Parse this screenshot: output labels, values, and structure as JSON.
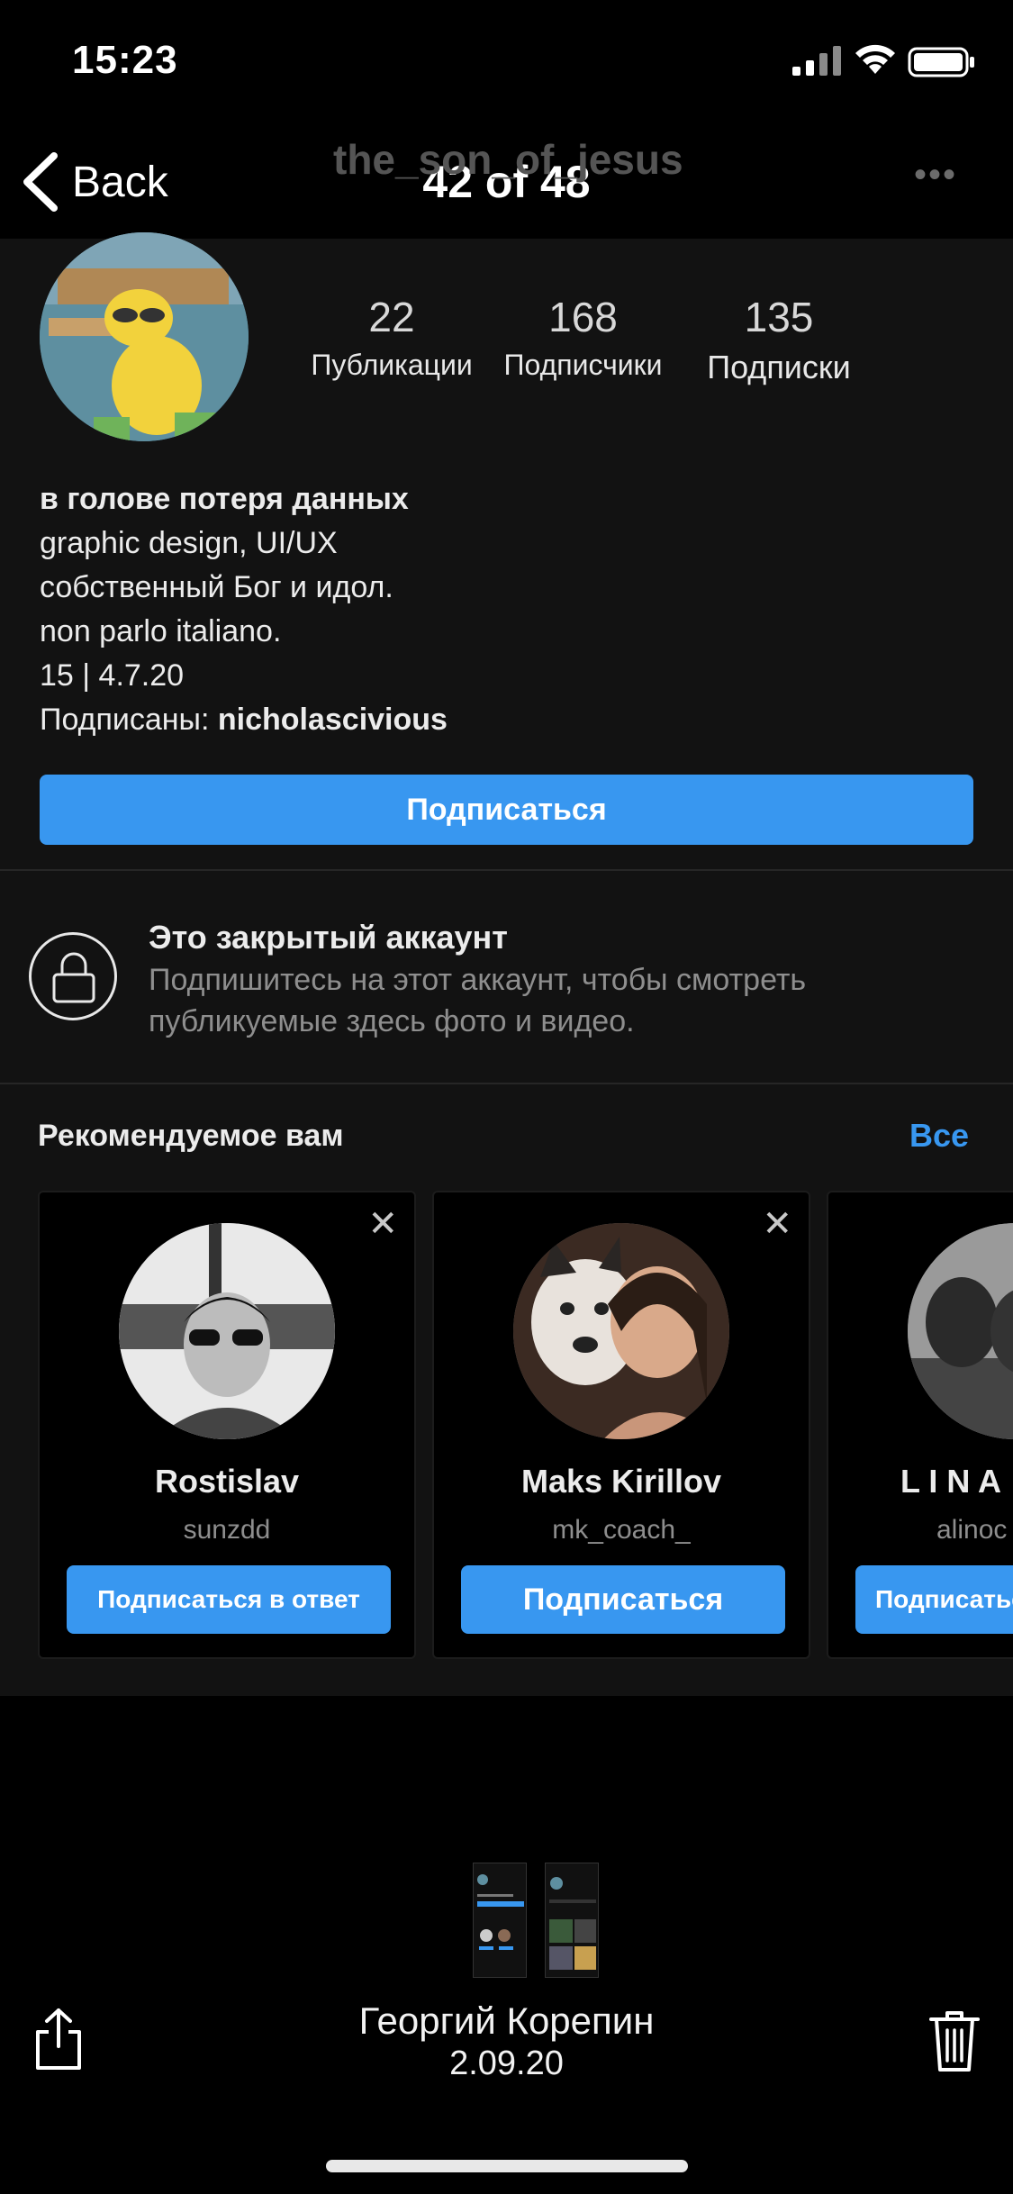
{
  "status_bar": {
    "time": "15:23"
  },
  "viewer": {
    "back_label": "Back",
    "counter": "42 of 48",
    "sender_name": "Георгий Корепин",
    "sent_date": "2.09.20"
  },
  "profile": {
    "username_header": "the_son_of_jesus",
    "stats": [
      {
        "value": "22",
        "label": "Публикации"
      },
      {
        "value": "168",
        "label": "Подписчики"
      },
      {
        "value": "135",
        "label": "Подписки"
      }
    ],
    "bio_name": "в голове потеря данных",
    "bio_lines": [
      "graphic design, UI/UX",
      "собственный Бог и идол.",
      "non parlo italiano.",
      "15 | 4.7.20"
    ],
    "followed_by_prefix": "Подписаны: ",
    "followed_by_user": "nicholascivious",
    "follow_button": "Подписаться",
    "private_title": "Это закрытый аккаунт",
    "private_subtitle": "Подпишитесь на этот аккаунт, чтобы смотреть публикуемые здесь фото и видео."
  },
  "suggestions": {
    "title": "Рекомендуемое вам",
    "see_all": "Все",
    "cards": [
      {
        "name": "Rostislav",
        "handle": "sunzdd",
        "button": "Подписаться в ответ"
      },
      {
        "name": "Maks Kirillov",
        "handle": "mk_coach_",
        "button": "Подписаться"
      },
      {
        "name": "L I N A",
        "handle": "alinoc",
        "button": "Подписаться"
      }
    ]
  },
  "colors": {
    "accent": "#3897f0",
    "background": "#000000",
    "panel": "#121212",
    "muted_text": "#8e8e8e"
  }
}
